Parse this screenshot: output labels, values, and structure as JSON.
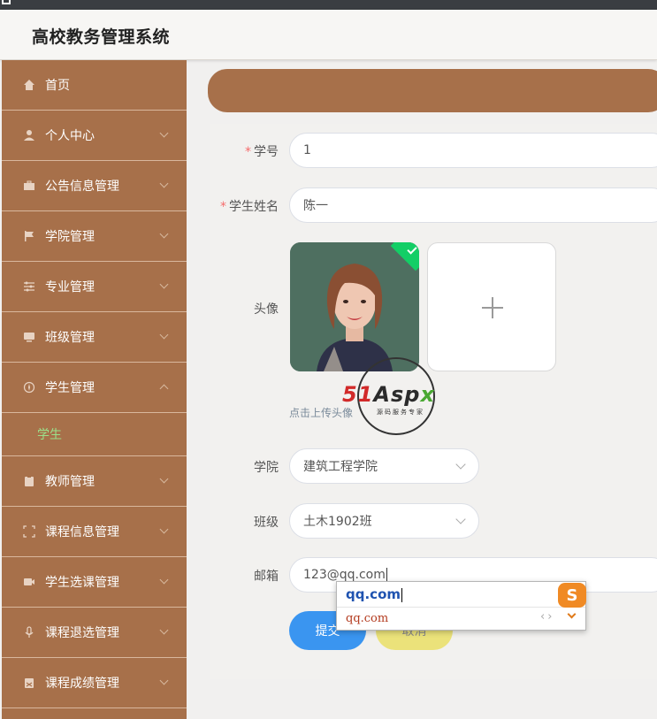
{
  "app": {
    "title": "高校教务管理系统"
  },
  "sidebar": {
    "items": [
      {
        "label": "首页",
        "icon": "home-icon"
      },
      {
        "label": "个人中心",
        "icon": "user-icon"
      },
      {
        "label": "公告信息管理",
        "icon": "briefcase-icon"
      },
      {
        "label": "学院管理",
        "icon": "flag-icon"
      },
      {
        "label": "专业管理",
        "icon": "sliders-icon"
      },
      {
        "label": "班级管理",
        "icon": "monitor-icon"
      },
      {
        "label": "学生管理",
        "icon": "compass-icon",
        "expanded": true
      },
      {
        "label": "教师管理",
        "icon": "clipboard-icon"
      },
      {
        "label": "课程信息管理",
        "icon": "fullscreen-icon"
      },
      {
        "label": "学生选课管理",
        "icon": "video-icon"
      },
      {
        "label": "课程退选管理",
        "icon": "microphone-icon"
      },
      {
        "label": "课程成绩管理",
        "icon": "calendar-icon"
      }
    ],
    "sub_items": {
      "student": "学生"
    }
  },
  "form": {
    "student_id": {
      "label": "学号",
      "value": "1"
    },
    "student_name": {
      "label": "学生姓名",
      "value": "陈一"
    },
    "avatar": {
      "label": "头像",
      "hint": "点击上传头像"
    },
    "college": {
      "label": "学院",
      "value": "建筑工程学院"
    },
    "class": {
      "label": "班级",
      "value": "土木1902班"
    },
    "email": {
      "label": "邮箱",
      "value": "123@qq.com"
    },
    "submit_label": "提交",
    "cancel_label": "取消"
  },
  "ime": {
    "composition": "qq.com",
    "candidate": "qq.com",
    "nav": "‹›",
    "logo": "S"
  },
  "watermark": {
    "brand_red": "51",
    "brand_dark": "Asp",
    "brand_green": "x",
    "subtitle": "源码服务专家"
  },
  "colors": {
    "sidebar": "#a7704a",
    "submit": "#3a95f0",
    "cancel": "#ebe27a",
    "active_submenu": "#9be08a"
  }
}
